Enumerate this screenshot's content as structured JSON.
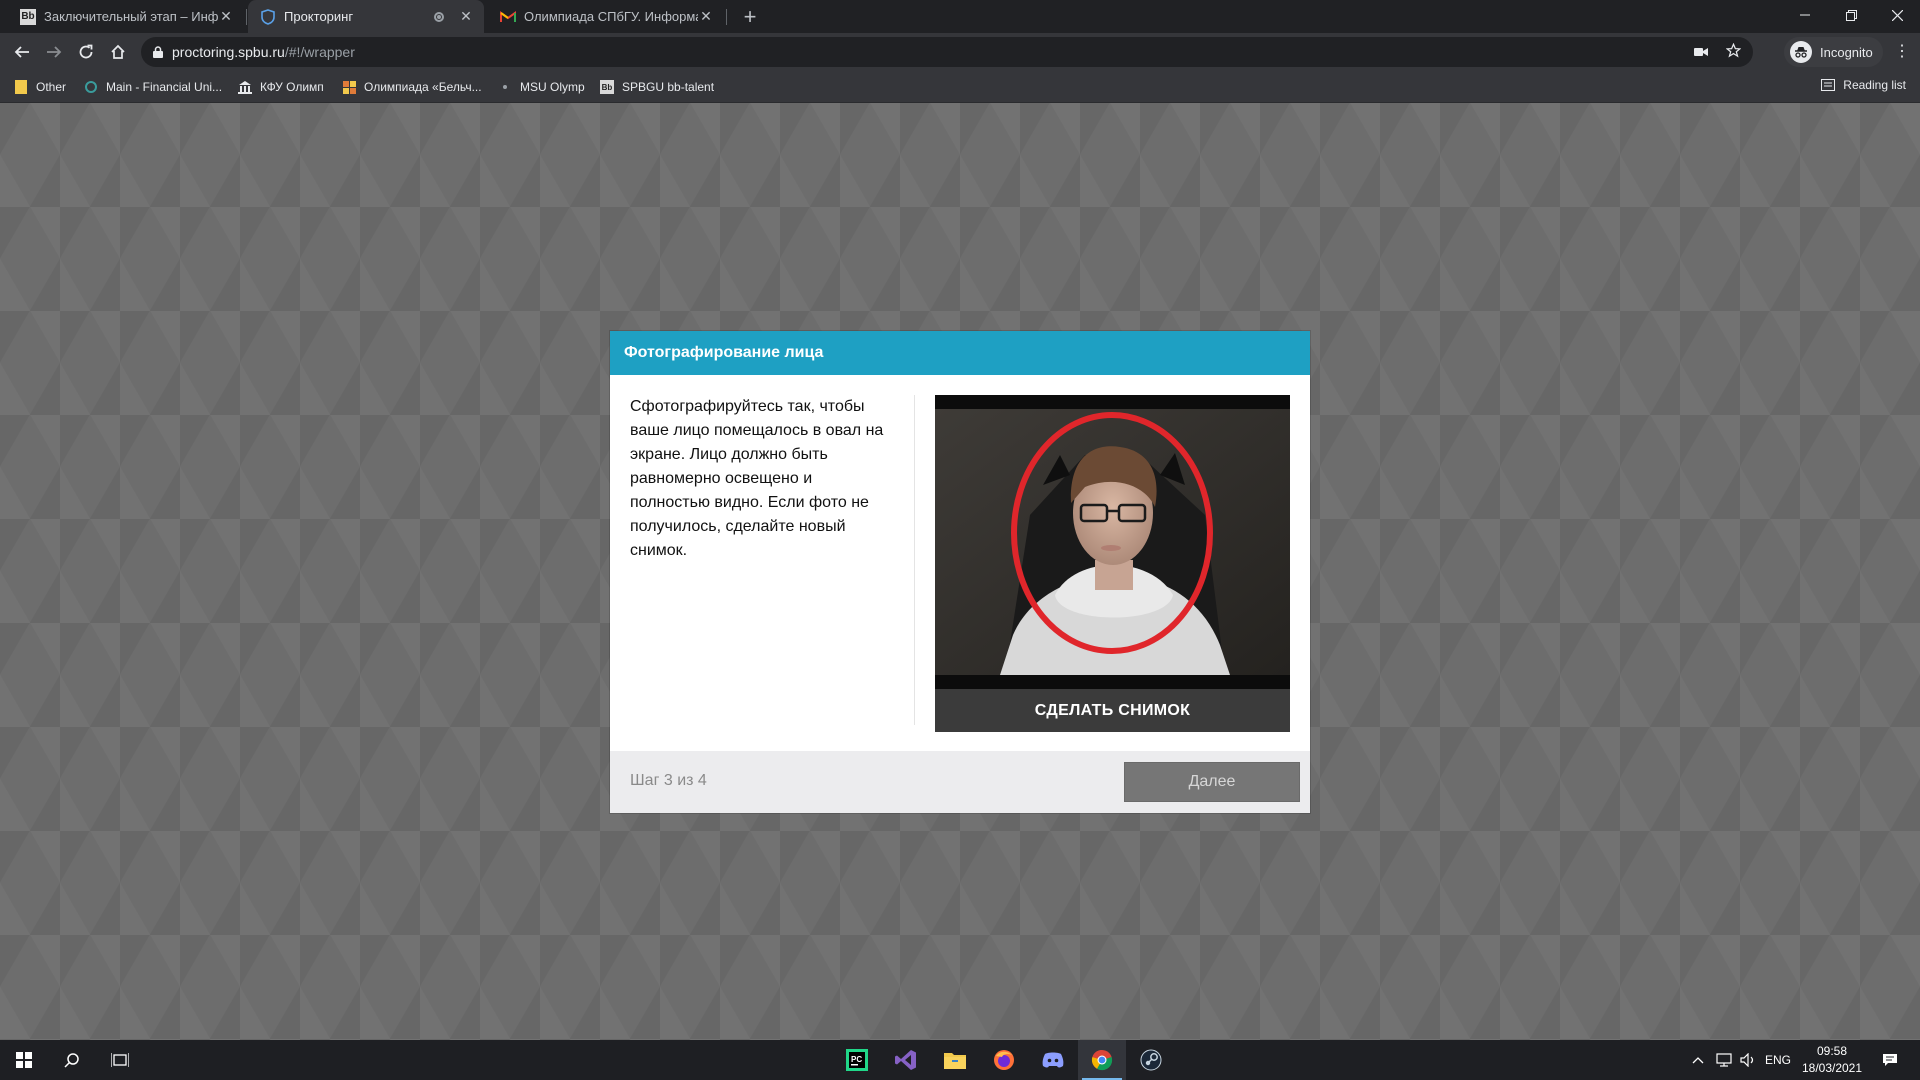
{
  "browser": {
    "tabs": [
      {
        "favicon": "Bb",
        "title": "Заключительный этап – Инфор"
      },
      {
        "favicon": "shield",
        "title": "Прокторинг"
      },
      {
        "favicon": "M",
        "title": "Олимпиада СПбГУ. Информати"
      }
    ],
    "url_host": "proctoring.spbu.ru",
    "url_path": "/#!/wrapper",
    "incognito_label": "Incognito",
    "bookmarks": [
      "Other",
      "Main - Financial Uni...",
      "КФУ Олимп",
      "Олимпиада «Бельч...",
      "MSU Olymp",
      "SPBGU bb-talent"
    ],
    "reading_list": "Reading list"
  },
  "modal": {
    "title": "Фотографирование лица",
    "instructions": "Сфотографируйтесь так, чтобы ваше лицо помещалось в овал на экране. Лицо должно быть равномерно освещено и полностью видно. Если фото не получилось, сделайте новый снимок.",
    "snapshot_button": "СДЕЛАТЬ СНИМОК",
    "step_text": "Шаг 3 из 4",
    "next_button": "Далее"
  },
  "taskbar": {
    "apps": [
      "pycharm-icon",
      "visual-studio-icon",
      "file-explorer-icon",
      "firefox-icon",
      "discord-icon",
      "chrome-icon",
      "steam-icon"
    ],
    "language": "ENG",
    "time": "09:58",
    "date": "18/03/2021"
  },
  "colors": {
    "header_accent": "#1ea0c3",
    "oval": "#e0262b",
    "snapshot_button": "#3b3b3b",
    "next_button": "#767676"
  }
}
